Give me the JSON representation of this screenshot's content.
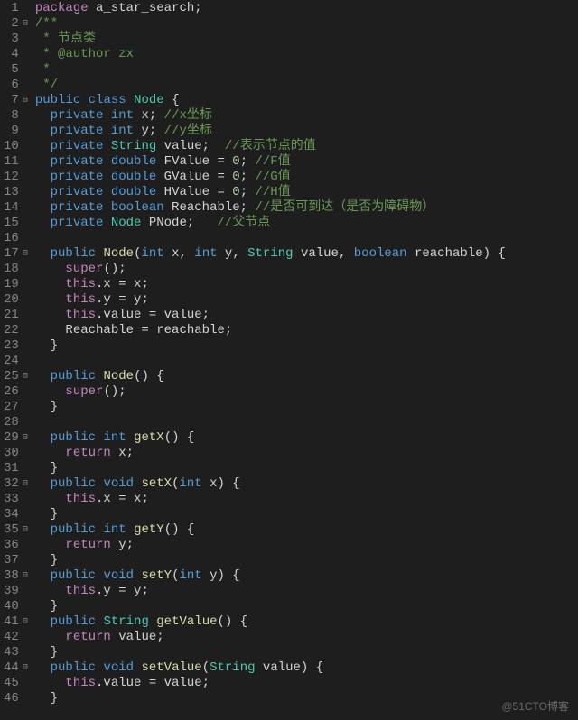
{
  "watermark": "@51CTO博客",
  "lines": [
    {
      "n": 1,
      "fold": "",
      "html": "<span class='kw'>package</span> a_star_search;"
    },
    {
      "n": 2,
      "fold": "⊟",
      "html": "<span class='com'>/**</span>"
    },
    {
      "n": 3,
      "fold": "",
      "html": "<span class='com'> * 节点类</span>"
    },
    {
      "n": 4,
      "fold": "",
      "html": "<span class='com'> * @author zx</span>"
    },
    {
      "n": 5,
      "fold": "",
      "html": "<span class='com'> *</span>"
    },
    {
      "n": 6,
      "fold": "",
      "html": "<span class='com'> */</span>"
    },
    {
      "n": 7,
      "fold": "⊟",
      "html": "<span class='mod'>public</span> <span class='mod'>class</span> <span class='type'>Node</span> {"
    },
    {
      "n": 8,
      "fold": "",
      "html": "  <span class='mod'>private</span> <span class='mod'>int</span> x; <span class='com'>//x坐标</span>"
    },
    {
      "n": 9,
      "fold": "",
      "html": "  <span class='mod'>private</span> <span class='mod'>int</span> y; <span class='com'>//y坐标</span>"
    },
    {
      "n": 10,
      "fold": "",
      "html": "  <span class='mod'>private</span> <span class='type'>String</span> value;  <span class='com'>//表示节点的值</span>"
    },
    {
      "n": 11,
      "fold": "",
      "html": "  <span class='mod'>private</span> <span class='mod'>double</span> FValue = <span class='num'>0</span>; <span class='com'>//F值</span>"
    },
    {
      "n": 12,
      "fold": "",
      "html": "  <span class='mod'>private</span> <span class='mod'>double</span> GValue = <span class='num'>0</span>; <span class='com'>//G值</span>"
    },
    {
      "n": 13,
      "fold": "",
      "html": "  <span class='mod'>private</span> <span class='mod'>double</span> HValue = <span class='num'>0</span>; <span class='com'>//H值</span>"
    },
    {
      "n": 14,
      "fold": "",
      "html": "  <span class='mod'>private</span> <span class='mod'>boolean</span> Reachable; <span class='com'>//是否可到达（是否为障碍物）</span>"
    },
    {
      "n": 15,
      "fold": "",
      "html": "  <span class='mod'>private</span> <span class='type'>Node</span> PNode;   <span class='com'>//父节点</span>"
    },
    {
      "n": 16,
      "fold": "",
      "html": ""
    },
    {
      "n": 17,
      "fold": "⊟",
      "html": "  <span class='mod'>public</span> <span class='fn'>Node</span>(<span class='mod'>int</span> x, <span class='mod'>int</span> y, <span class='type'>String</span> value, <span class='mod'>boolean</span> reachable) {"
    },
    {
      "n": 18,
      "fold": "",
      "html": "    <span class='kw'>super</span>();"
    },
    {
      "n": 19,
      "fold": "",
      "html": "    <span class='kw'>this</span>.x = x;"
    },
    {
      "n": 20,
      "fold": "",
      "html": "    <span class='kw'>this</span>.y = y;"
    },
    {
      "n": 21,
      "fold": "",
      "html": "    <span class='kw'>this</span>.value = value;"
    },
    {
      "n": 22,
      "fold": "",
      "html": "    Reachable = reachable;"
    },
    {
      "n": 23,
      "fold": "",
      "html": "  }"
    },
    {
      "n": 24,
      "fold": "",
      "html": ""
    },
    {
      "n": 25,
      "fold": "⊟",
      "html": "  <span class='mod'>public</span> <span class='fn'>Node</span>() {"
    },
    {
      "n": 26,
      "fold": "",
      "html": "    <span class='kw'>super</span>();"
    },
    {
      "n": 27,
      "fold": "",
      "html": "  }"
    },
    {
      "n": 28,
      "fold": "",
      "html": ""
    },
    {
      "n": 29,
      "fold": "⊟",
      "html": "  <span class='mod'>public</span> <span class='mod'>int</span> <span class='fn'>getX</span>() {"
    },
    {
      "n": 30,
      "fold": "",
      "html": "    <span class='kw'>return</span> x;"
    },
    {
      "n": 31,
      "fold": "",
      "html": "  }"
    },
    {
      "n": 32,
      "fold": "⊟",
      "html": "  <span class='mod'>public</span> <span class='mod'>void</span> <span class='fn'>setX</span>(<span class='mod'>int</span> x) {"
    },
    {
      "n": 33,
      "fold": "",
      "html": "    <span class='kw'>this</span>.x = x;"
    },
    {
      "n": 34,
      "fold": "",
      "html": "  }"
    },
    {
      "n": 35,
      "fold": "⊟",
      "html": "  <span class='mod'>public</span> <span class='mod'>int</span> <span class='fn'>getY</span>() {"
    },
    {
      "n": 36,
      "fold": "",
      "html": "    <span class='kw'>return</span> y;"
    },
    {
      "n": 37,
      "fold": "",
      "html": "  }"
    },
    {
      "n": 38,
      "fold": "⊟",
      "html": "  <span class='mod'>public</span> <span class='mod'>void</span> <span class='fn'>setY</span>(<span class='mod'>int</span> y) {"
    },
    {
      "n": 39,
      "fold": "",
      "html": "    <span class='kw'>this</span>.y = y;"
    },
    {
      "n": 40,
      "fold": "",
      "html": "  }"
    },
    {
      "n": 41,
      "fold": "⊟",
      "html": "  <span class='mod'>public</span> <span class='type'>String</span> <span class='fn'>getValue</span>() {"
    },
    {
      "n": 42,
      "fold": "",
      "html": "    <span class='kw'>return</span> value;"
    },
    {
      "n": 43,
      "fold": "",
      "html": "  }"
    },
    {
      "n": 44,
      "fold": "⊟",
      "html": "  <span class='mod'>public</span> <span class='mod'>void</span> <span class='fn'>setValue</span>(<span class='type'>String</span> value) {"
    },
    {
      "n": 45,
      "fold": "",
      "html": "    <span class='kw'>this</span>.value = value;"
    },
    {
      "n": 46,
      "fold": "",
      "html": "  }"
    }
  ]
}
